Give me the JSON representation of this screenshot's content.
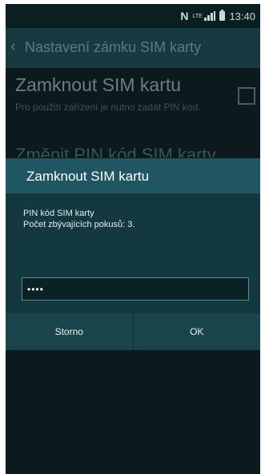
{
  "status_bar": {
    "time": "13:40",
    "network_label": "LTE",
    "icons": [
      "nfc-icon",
      "lte-icon",
      "signal-icon",
      "battery-icon"
    ]
  },
  "header": {
    "title": "Nastavení zámku SIM karty",
    "back_icon": "chevron-left-icon"
  },
  "settings": {
    "lock_sim": {
      "title": "Zamknout SIM kartu",
      "description": "Pro použití zařízení je nutno zadat PIN kód.",
      "checked": false
    },
    "change_pin": {
      "title": "Změnit PIN kód SIM karty"
    }
  },
  "dialog": {
    "title": "Zamknout SIM kartu",
    "message_line1": "PIN kód SIM karty",
    "message_line2": "Počet zbývajících pokusů: 3.",
    "pin_value": "••••",
    "cancel_label": "Storno",
    "ok_label": "OK"
  },
  "colors": {
    "dialog_header": "#1f5661",
    "dialog_body": "#14383f",
    "button_row": "#1a444b",
    "status_bar": "#0b1e22"
  }
}
